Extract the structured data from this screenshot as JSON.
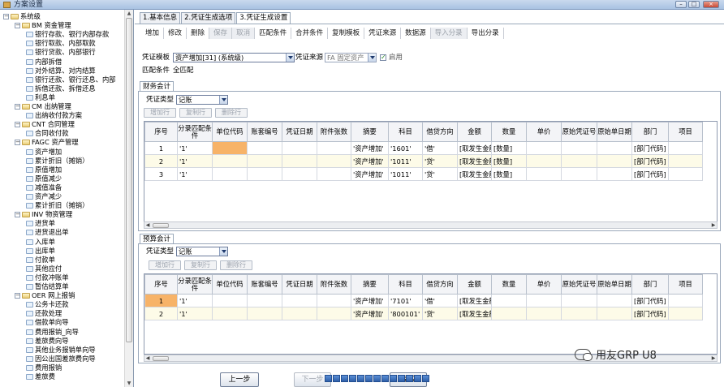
{
  "window": {
    "title": "方案设置"
  },
  "tree": [
    {
      "label": "系统级",
      "level": 0,
      "kind": "root"
    },
    {
      "label": "BM 资金管理",
      "level": 1,
      "kind": "folder"
    },
    {
      "label": "银行存款、银行内部存款",
      "level": 2,
      "kind": "leaf"
    },
    {
      "label": "银行取款、内部取款",
      "level": 2,
      "kind": "leaf"
    },
    {
      "label": "银行贷款、内部银行",
      "level": 2,
      "kind": "leaf"
    },
    {
      "label": "内部拆借",
      "level": 2,
      "kind": "leaf"
    },
    {
      "label": "对外结算、对内结算",
      "level": 2,
      "kind": "leaf"
    },
    {
      "label": "银行还款、银行还息、内部",
      "level": 2,
      "kind": "leaf"
    },
    {
      "label": "拆借还款、拆借还息",
      "level": 2,
      "kind": "leaf"
    },
    {
      "label": "利息单",
      "level": 2,
      "kind": "leaf"
    },
    {
      "label": "CM 出纳管理",
      "level": 1,
      "kind": "folder"
    },
    {
      "label": "出纳收付款方案",
      "level": 2,
      "kind": "leaf"
    },
    {
      "label": "CNT 合同管理",
      "level": 1,
      "kind": "folder"
    },
    {
      "label": "合同收付款",
      "level": 2,
      "kind": "leaf"
    },
    {
      "label": "FAGC 资产管理",
      "level": 1,
      "kind": "folder"
    },
    {
      "label": "资产增加",
      "level": 2,
      "kind": "leaf"
    },
    {
      "label": "累计折旧（摊销）",
      "level": 2,
      "kind": "leaf"
    },
    {
      "label": "原值增加",
      "level": 2,
      "kind": "leaf"
    },
    {
      "label": "原值减少",
      "level": 2,
      "kind": "leaf"
    },
    {
      "label": "减值准备",
      "level": 2,
      "kind": "leaf"
    },
    {
      "label": "资产减少",
      "level": 2,
      "kind": "leaf"
    },
    {
      "label": "累计折旧（摊销）",
      "level": 2,
      "kind": "leaf"
    },
    {
      "label": "INV 物资管理",
      "level": 1,
      "kind": "folder"
    },
    {
      "label": "进货单",
      "level": 2,
      "kind": "leaf"
    },
    {
      "label": "进货退出单",
      "level": 2,
      "kind": "leaf"
    },
    {
      "label": "入库单",
      "level": 2,
      "kind": "leaf"
    },
    {
      "label": "出库单",
      "level": 2,
      "kind": "leaf"
    },
    {
      "label": "付款单",
      "level": 2,
      "kind": "leaf"
    },
    {
      "label": "其他应付",
      "level": 2,
      "kind": "leaf"
    },
    {
      "label": "付款冲账单",
      "level": 2,
      "kind": "leaf"
    },
    {
      "label": "暂估结算单",
      "level": 2,
      "kind": "leaf"
    },
    {
      "label": "OER 网上报销",
      "level": 1,
      "kind": "folder"
    },
    {
      "label": "公务卡还款",
      "level": 2,
      "kind": "leaf"
    },
    {
      "label": "还款处理",
      "level": 2,
      "kind": "leaf"
    },
    {
      "label": "借款单向导",
      "level": 2,
      "kind": "leaf"
    },
    {
      "label": "费用报销_向导",
      "level": 2,
      "kind": "leaf"
    },
    {
      "label": "差旅费向导",
      "level": 2,
      "kind": "leaf"
    },
    {
      "label": "其他业务报销单向导",
      "level": 2,
      "kind": "leaf"
    },
    {
      "label": "因公出国差旅费向导",
      "level": 2,
      "kind": "leaf"
    },
    {
      "label": "费用报销",
      "level": 2,
      "kind": "leaf"
    },
    {
      "label": "差旅费",
      "level": 2,
      "kind": "leaf"
    }
  ],
  "tabs": [
    "1.基本信息",
    "2.凭证生成选项",
    "3.凭证生成设置"
  ],
  "toolbar": [
    {
      "label": "增加",
      "enabled": true
    },
    {
      "label": "修改",
      "enabled": true
    },
    {
      "label": "删除",
      "enabled": true
    },
    {
      "label": "保存",
      "enabled": false
    },
    {
      "label": "取消",
      "enabled": false
    },
    {
      "label": "匹配条件",
      "enabled": true
    },
    {
      "label": "合并条件",
      "enabled": true
    },
    {
      "label": "复制模板",
      "enabled": true
    },
    {
      "label": "凭证来源",
      "enabled": true
    },
    {
      "label": "数据源",
      "enabled": true
    },
    {
      "label": "导入分录",
      "enabled": false
    },
    {
      "label": "导出分录",
      "enabled": true
    }
  ],
  "form": {
    "template_label": "凭证模板",
    "template_value": "资产增加[31] (系统级)",
    "source_label": "凭证来源",
    "source_value": "FA 固定资产",
    "enable_label": "启用",
    "enable_checked": true,
    "match_label": "匹配条件",
    "match_value": "全匹配"
  },
  "columns": [
    "序号",
    "分录匹配条件",
    "单位代码",
    "账套编号",
    "凭证日期",
    "附件张数",
    "摘要",
    "科目",
    "借贷方向",
    "金额",
    "数量",
    "单价",
    "原始凭证号",
    "原始单日期",
    "部门",
    "项目"
  ],
  "finance": {
    "tab": "财务会计",
    "vtype_label": "凭证类型",
    "vtype_value": "记账",
    "btn_add": "增加行",
    "btn_copy": "复制行",
    "btn_del": "删除行",
    "rows": [
      [
        "1",
        "'1'",
        "",
        "",
        "",
        "",
        "'资产增加'",
        "'1601'",
        "'借'",
        "[取发生金额",
        "[数量]",
        "",
        "",
        "",
        "[部门代码]",
        ""
      ],
      [
        "2",
        "'1'",
        "",
        "",
        "",
        "",
        "'资产增加'",
        "'1011'",
        "'贷'",
        "[取发生金额",
        "[数量]",
        "",
        "",
        "",
        "[部门代码]",
        ""
      ],
      [
        "3",
        "'1'",
        "",
        "",
        "",
        "",
        "'资产增加'",
        "'1011'",
        "'贷'",
        "[取发生金额",
        "[数量]",
        "",
        "",
        "",
        "[部门代码]",
        ""
      ]
    ]
  },
  "budget": {
    "tab": "预算会计",
    "vtype_label": "凭证类型",
    "vtype_value": "记账",
    "btn_add": "增加行",
    "btn_copy": "复制行",
    "btn_del": "删除行",
    "rows": [
      [
        "1",
        "'1'",
        "",
        "",
        "",
        "",
        "'资产增加'",
        "'7101'",
        "'借'",
        "[取发生金额",
        "",
        "",
        "",
        "",
        "[部门代码]",
        ""
      ],
      [
        "2",
        "'1'",
        "",
        "",
        "",
        "",
        "'资产增加'",
        "'800101'",
        "'贷'",
        "[取发生金额",
        "",
        "",
        "",
        "",
        "[部门代码]",
        ""
      ]
    ]
  },
  "footer": {
    "prev": "上一步",
    "next": "下一步",
    "finish": "完成"
  },
  "watermark": "用友GRP U8"
}
